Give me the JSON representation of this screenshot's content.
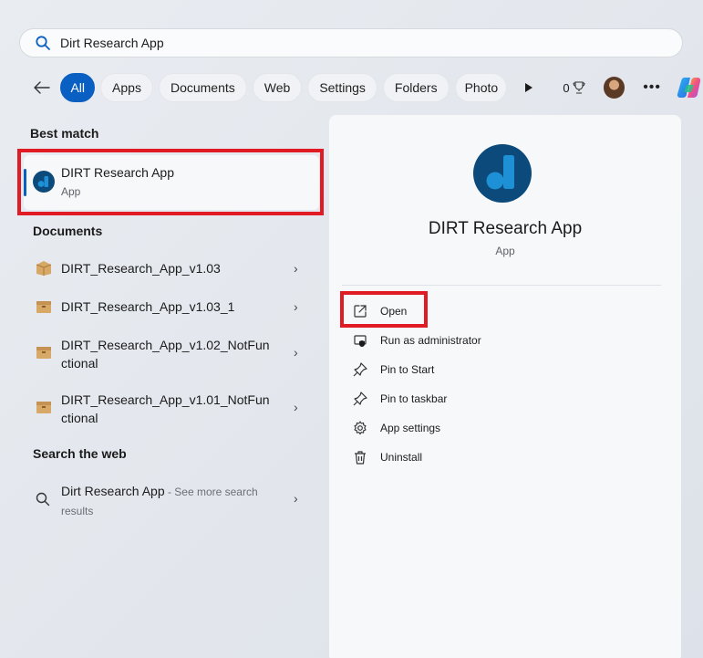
{
  "search": {
    "value": "Dirt Research App"
  },
  "filters": {
    "chips": [
      "All",
      "Apps",
      "Documents",
      "Web",
      "Settings",
      "Folders",
      "Photo"
    ],
    "points": "0"
  },
  "best_match": {
    "title": "Best match",
    "name": "DIRT Research App",
    "type": "App"
  },
  "documents": {
    "title": "Documents",
    "items": [
      {
        "line1": "DIRT_Research_App_v1.03",
        "line2": ""
      },
      {
        "line1": "DIRT_Research_App_v1.03_1",
        "line2": ""
      },
      {
        "line1": "DIRT_Research_App_v1.02_NotFun",
        "line2": "ctional"
      },
      {
        "line1": "DIRT_Research_App_v1.01_NotFun",
        "line2": "ctional"
      }
    ]
  },
  "web": {
    "title": "Search the web",
    "query": "Dirt Research App",
    "suffix": " - See more search",
    "suffix2": "results"
  },
  "detail": {
    "name": "DIRT Research App",
    "type": "App",
    "actions": [
      "Open",
      "Run as administrator",
      "Pin to Start",
      "Pin to taskbar",
      "App settings",
      "Uninstall"
    ]
  },
  "colors": {
    "accent": "#0a5fc2",
    "app_icon_bg": "#0b4a7a",
    "app_icon_fg": "#1e90d6",
    "highlight": "#e01b24"
  },
  "icons": {
    "search": "search-icon",
    "back": "back-arrow-icon",
    "play": "play-icon",
    "trophy": "trophy-icon",
    "more": "more-icon",
    "copilot": "copilot-icon",
    "doc": "package-icon",
    "open": "open-external-icon",
    "admin": "shield-icon",
    "pin": "pin-icon",
    "settings": "gear-icon",
    "uninstall": "trash-icon"
  }
}
